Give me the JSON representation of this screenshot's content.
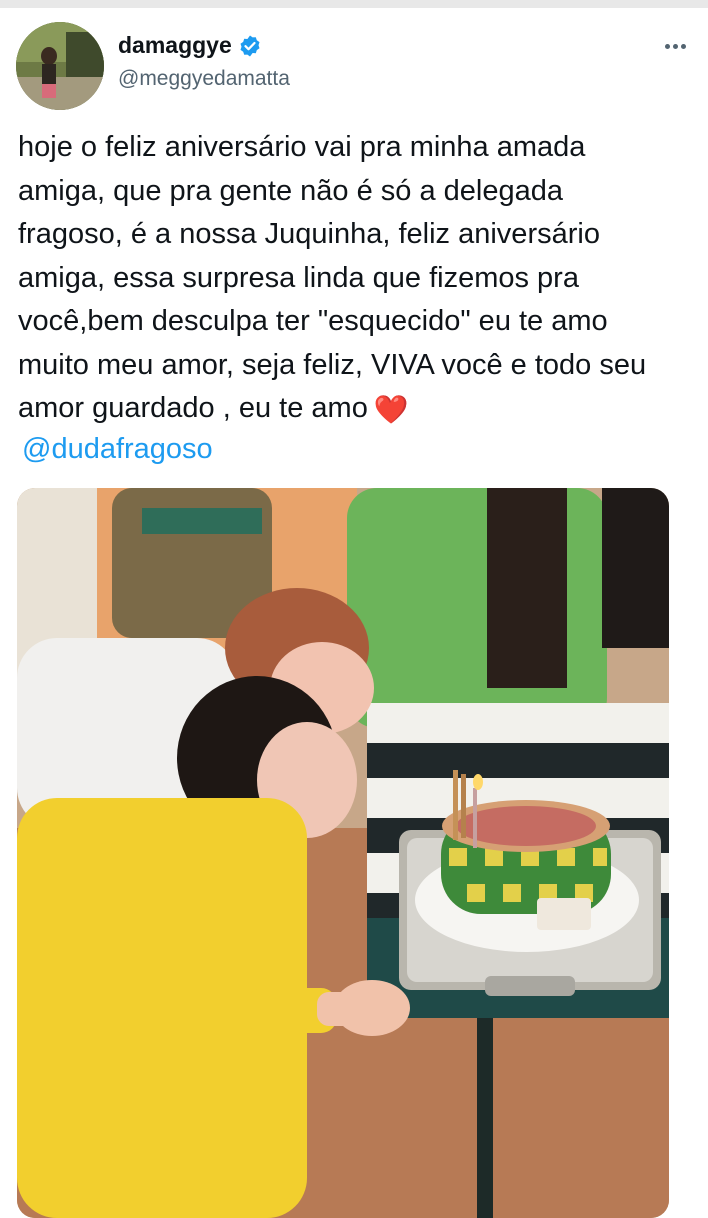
{
  "account": {
    "display_name": "damaggye",
    "handle": "@meggyedamatta",
    "verified": true,
    "avatar_icon": "profile-photo-avatar"
  },
  "menu": {
    "more_icon": "more-options-icon"
  },
  "tweet": {
    "lines": [
      "hoje o feliz aniversário vai pra minha amada",
      "amiga, que pra gente não é só a delegada",
      "fragoso, é a nossa Juquinha, feliz aniversário",
      "amiga, essa surpresa linda que fizemos pra",
      "você,bem desculpa ter \"esquecido\" eu te amo",
      "muito meu amor, seja feliz, VIVA você e todo seu",
      "amor guardado , eu te amo"
    ],
    "emoji": "❤️",
    "mention": "@dudafragoso"
  },
  "media": {
    "kind": "photo",
    "icon": "birthday-cake-photo"
  },
  "colors": {
    "link": "#1d9bf0",
    "verified": "#1d9bf0",
    "text": "#0f1419",
    "secondary": "#536471"
  }
}
